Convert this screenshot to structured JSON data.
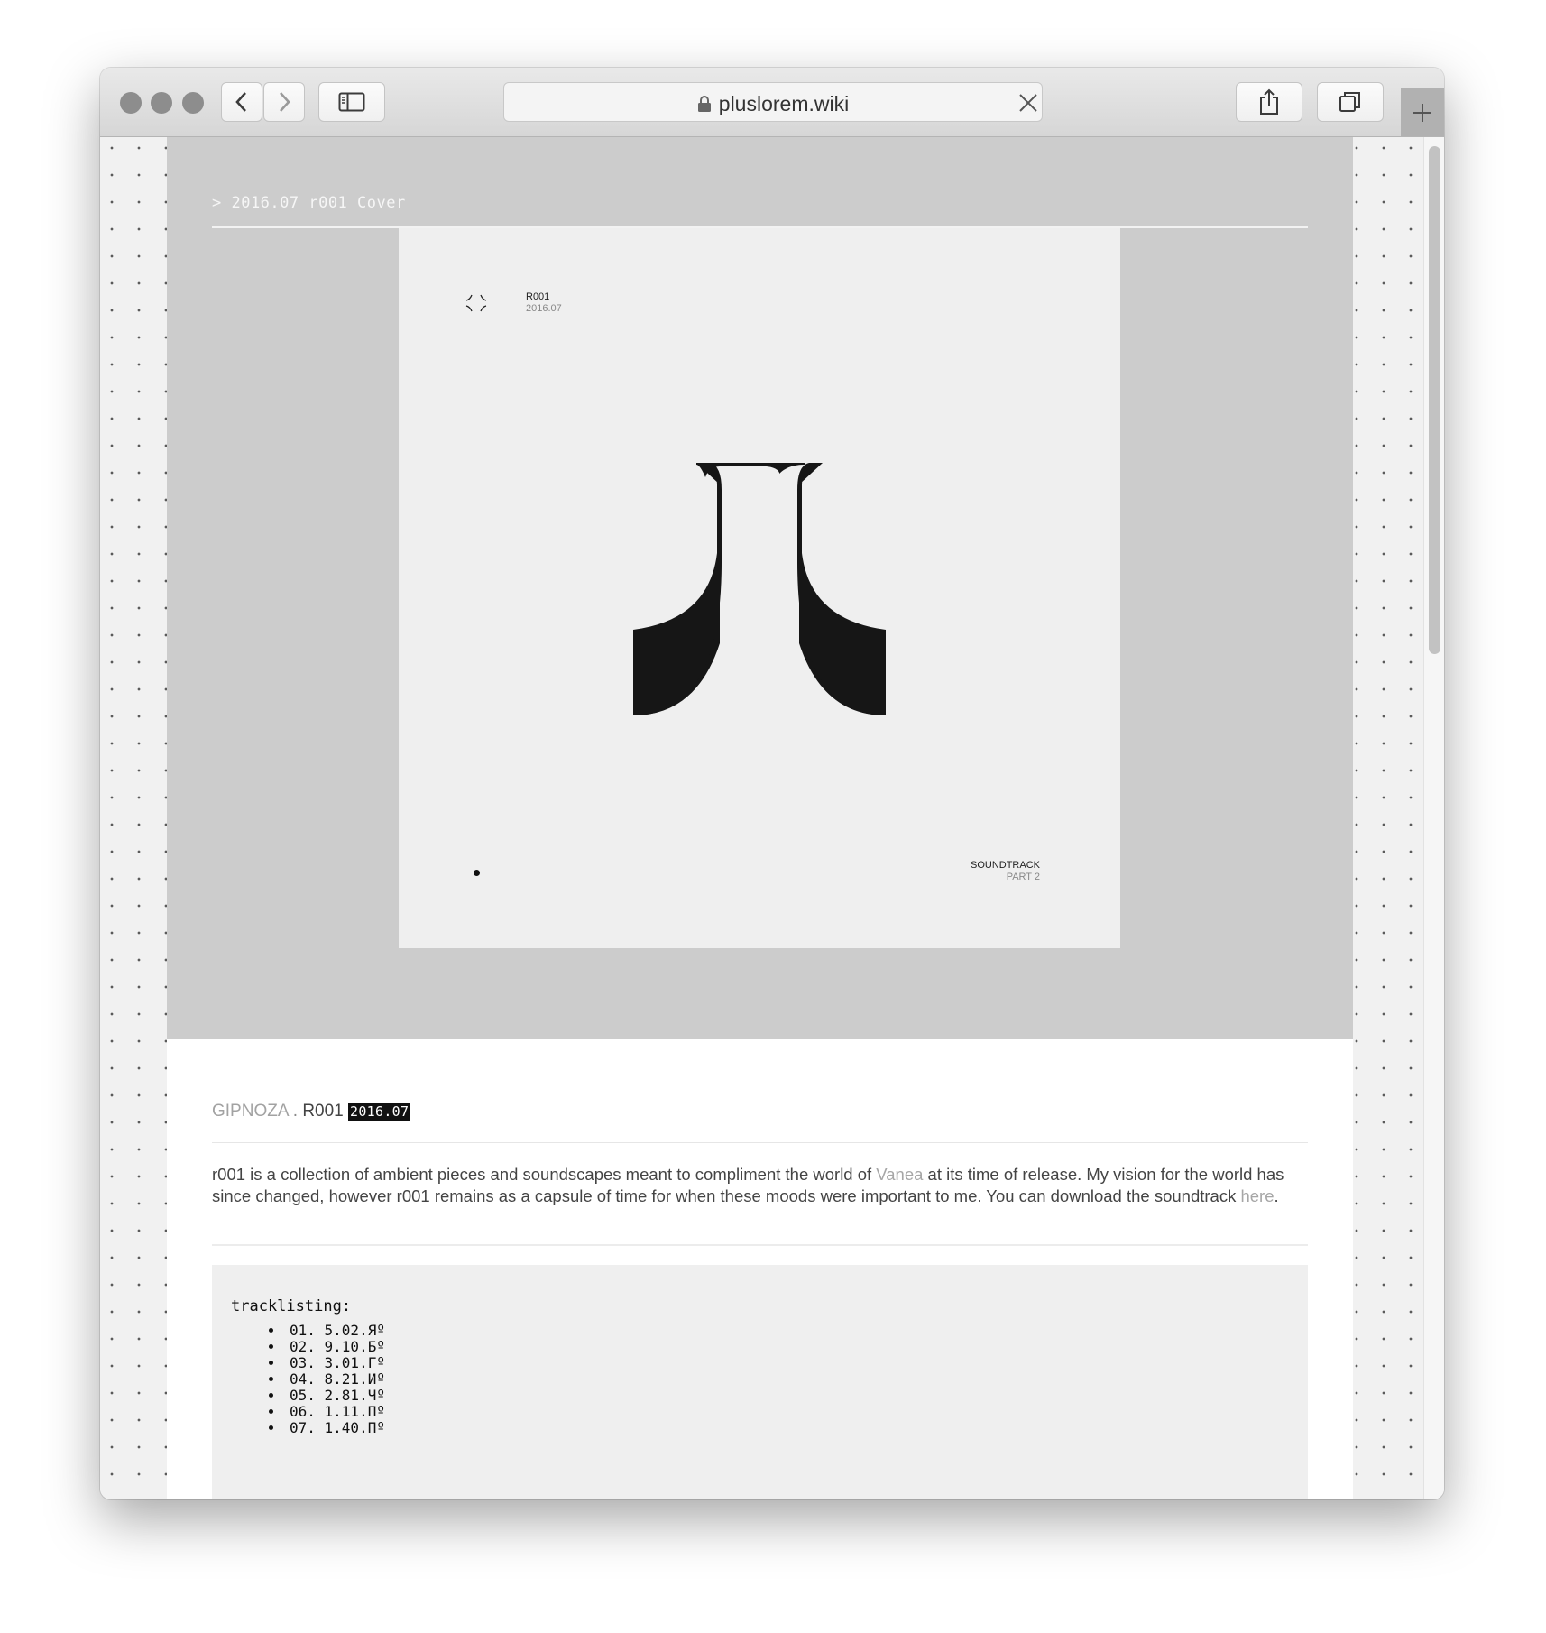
{
  "browser": {
    "url": "pluslorem.wiki",
    "icons": {
      "back": "chevron-left-icon",
      "forward": "chevron-right-icon",
      "sidebar": "sidebar-icon",
      "lock": "lock-icon",
      "stop": "close-icon",
      "share": "share-icon",
      "tabs": "tabs-icon",
      "new_tab": "plus-icon"
    }
  },
  "page": {
    "breadcrumb": "> 2016.07 r001 Cover",
    "cover": {
      "code": "R001",
      "date": "2016.07",
      "subtitle_line1": "SOUNDTRACK",
      "subtitle_line2": "PART 2"
    },
    "release": {
      "artist": "GIPNOZA",
      "separator": " . ",
      "code": "R001",
      "date": "2016.07"
    },
    "description": {
      "part1": "r001 is a collection of ambient pieces and soundscapes meant to compliment the world of ",
      "link1": "Vanea",
      "part2": " at its time of release. My vision for the world has since changed, however r001 remains as a capsule of time for when these moods were important to me. You can download the soundtrack ",
      "link2": "here",
      "part3": "."
    },
    "tracklisting": {
      "title": "tracklisting:",
      "tracks": [
        "01. 5.02.Яº",
        "02. 9.10.Бº",
        "03. 3.01.Гº",
        "04. 8.21.Иº",
        "05. 2.81.Чº",
        "06. 1.11.Пº",
        "07. 1.40.Пº"
      ]
    }
  },
  "colors": {
    "hero_bg": "#cccccc",
    "cover_bg": "#efefef",
    "link": "#a6a6a6",
    "badge_bg": "#111111"
  }
}
